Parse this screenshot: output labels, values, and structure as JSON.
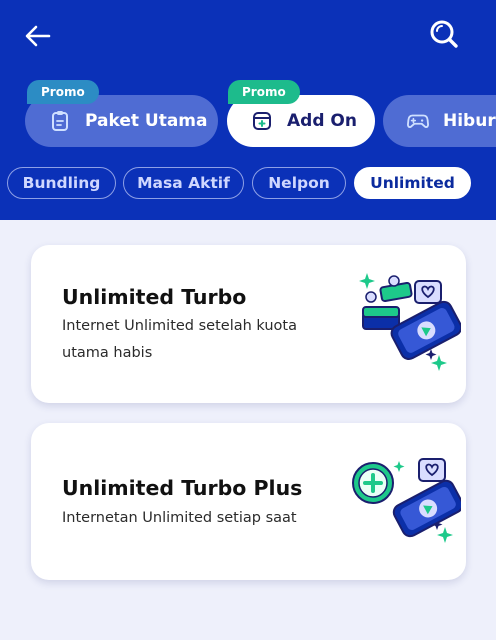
{
  "header": {
    "back_icon": "arrow-left-icon",
    "search_icon": "search-icon",
    "bg_color": "#0b31b8"
  },
  "categories": [
    {
      "label": "Paket Utama",
      "promo": "Promo",
      "icon": "clipboard-icon"
    },
    {
      "label": "Add On",
      "promo": "Promo",
      "icon": "add-box-icon",
      "active": true
    },
    {
      "label": "Hiburan",
      "icon": "gamepad-icon"
    }
  ],
  "chips": [
    "Bundling",
    "Masa Aktif",
    "Nelpon",
    "Unlimited"
  ],
  "active_chip": "Unlimited",
  "cards": [
    {
      "title": "Unlimited Turbo",
      "description": "Internet Unlimited setelah kuota utama habis",
      "illustration": "phone-play-illustration"
    },
    {
      "title": "Unlimited Turbo Plus",
      "description": "Internetan Unlimited setiap saat",
      "illustration": "phone-plus-illustration"
    }
  ],
  "colors": {
    "promo_blue": "#2c8cc4",
    "promo_green": "#1dbb8c",
    "accent_green": "#1dc98a"
  }
}
